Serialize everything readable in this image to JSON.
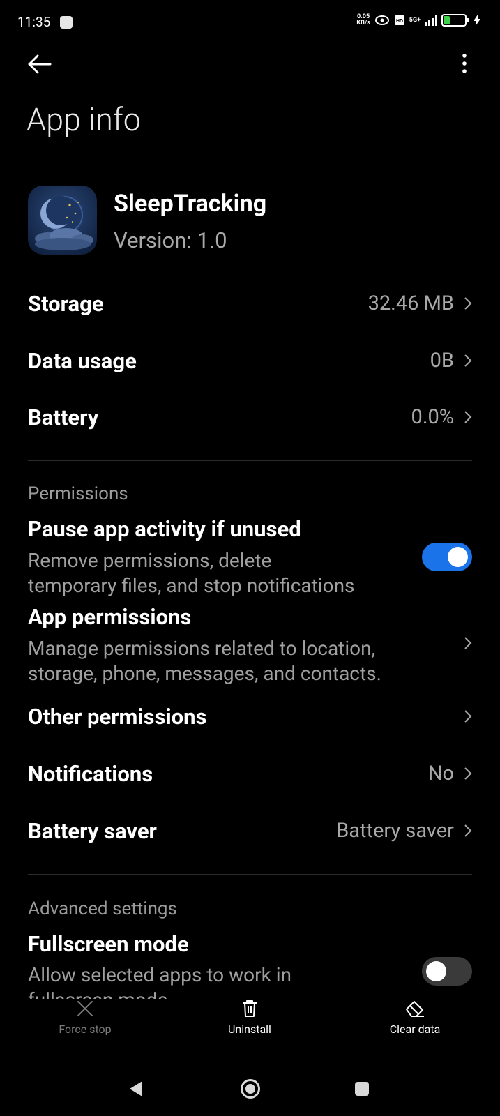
{
  "status_bar": {
    "time": "11:35",
    "net_speed_value": "0.05",
    "net_speed_unit": "KB/s",
    "battery_level": "28",
    "network": "5G+"
  },
  "header": {
    "title": "App info"
  },
  "app": {
    "name": "SleepTracking",
    "version": "Version: 1.0"
  },
  "summary_rows": [
    {
      "label": "Storage",
      "value": "32.46 MB"
    },
    {
      "label": "Data usage",
      "value": "0B"
    },
    {
      "label": "Battery",
      "value": "0.0%"
    }
  ],
  "permissions": {
    "section_title": "Permissions",
    "pause_activity": {
      "title": "Pause app activity if unused",
      "desc_line1": "Remove permissions, delete",
      "desc_line2": "temporary files, and stop notifications",
      "enabled": true
    },
    "app_permissions": {
      "title": "App permissions",
      "desc_line1": "Manage permissions related to location,",
      "desc_line2": "storage, phone, messages, and contacts."
    },
    "other_permissions": {
      "label": "Other permissions"
    },
    "notifications": {
      "label": "Notifications",
      "value": "No"
    },
    "battery_saver": {
      "label": "Battery saver",
      "value": "Battery saver"
    }
  },
  "advanced": {
    "section_title": "Advanced settings",
    "fullscreen": {
      "title": "Fullscreen mode",
      "desc_line1": "Allow selected apps to work in",
      "desc_line2": "fullscreen mode",
      "enabled": false
    }
  },
  "actions": {
    "force_stop": "Force stop",
    "uninstall": "Uninstall",
    "clear_data": "Clear data"
  },
  "colors": {
    "background": "#000000",
    "accent": "#1a73e8",
    "secondary_text": "#a8a8a8",
    "toggle_off": "#3a3a3a",
    "disabled_text": "#7a7a7a"
  }
}
